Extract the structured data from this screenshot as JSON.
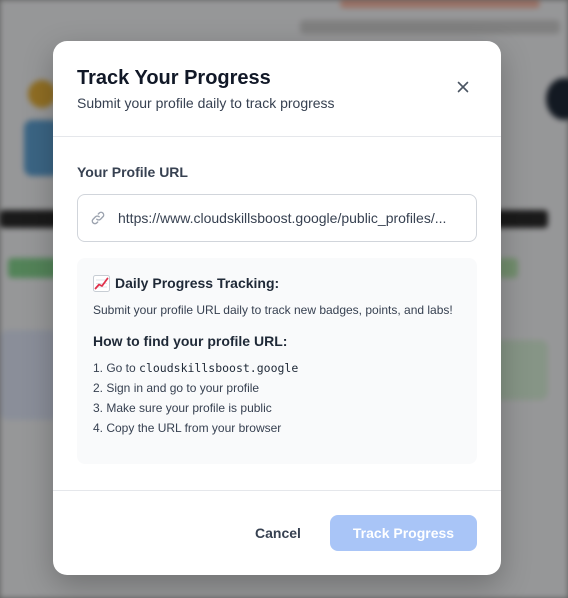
{
  "modal": {
    "title": "Track Your Progress",
    "subtitle": "Submit your profile daily to track progress",
    "close_icon": "close-icon"
  },
  "form": {
    "label": "Your Profile URL",
    "url_value": "https://www.cloudskillsboost.google/public_profiles/...",
    "input_icon": "link-icon"
  },
  "info": {
    "icon": "chart-increasing-icon",
    "heading": "Daily Progress Tracking:",
    "text": "Submit your profile URL daily to track new badges, points, and labs!",
    "howto_heading": "How to find your profile URL:",
    "steps": {
      "s1_prefix": "1. Go to ",
      "s1_code": "cloudskillsboost.google",
      "s2": "2. Sign in and go to your profile",
      "s3": "3. Make sure your profile is public",
      "s4": "4. Copy the URL from your browser"
    }
  },
  "footer": {
    "cancel_label": "Cancel",
    "submit_label": "Track Progress"
  },
  "colors": {
    "primary_disabled": "#a9c5f7",
    "overlay": "rgba(0,0,0,0.38)"
  }
}
